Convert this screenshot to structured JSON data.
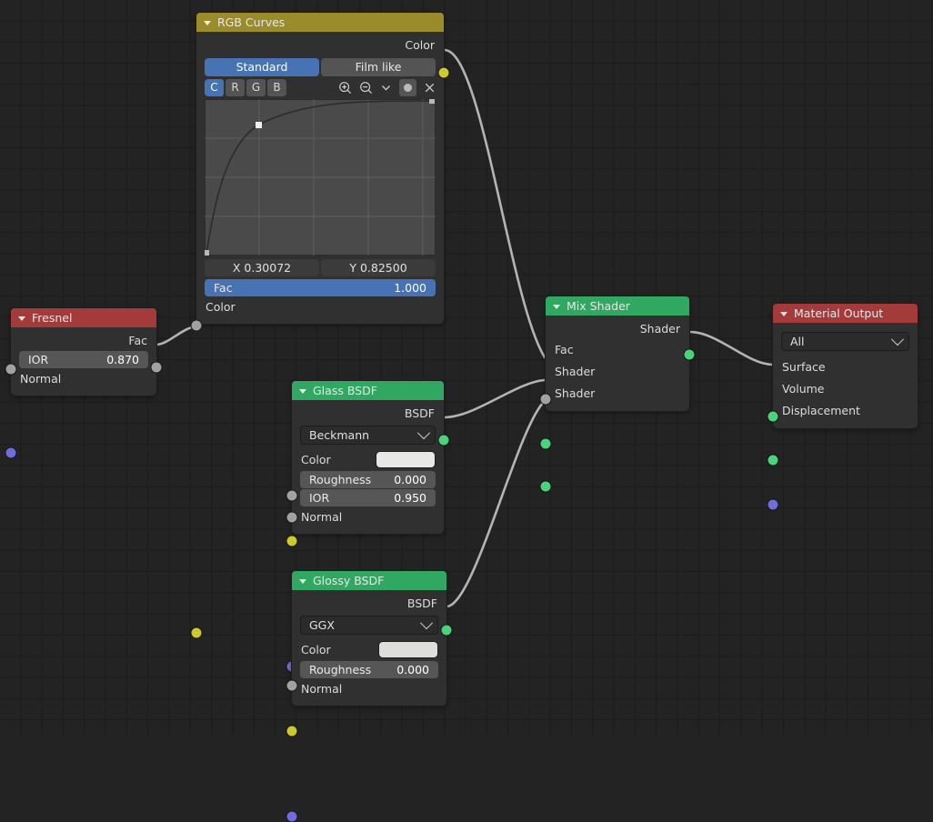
{
  "editor": {
    "name": "blender-shader-node-editor",
    "background_color": "#232323",
    "grid_color": "#1b1b1b",
    "wire_color": "#b0b0b0"
  },
  "socket_colors": {
    "color": "#ccc92e",
    "value": "#a1a1a1",
    "shader": "#4bd37b",
    "vector": "#6d6de0"
  },
  "nodes": {
    "rgb_curves": {
      "title": "RGB Curves",
      "header_color": "#9a8c2b",
      "outputs": [
        {
          "label": "Color",
          "socket": "color"
        }
      ],
      "view_modes": [
        {
          "label": "Standard",
          "active": true
        },
        {
          "label": "Film like",
          "active": false
        }
      ],
      "channels": [
        {
          "label": "C",
          "active": true
        },
        {
          "label": "R",
          "active": false
        },
        {
          "label": "G",
          "active": false
        },
        {
          "label": "B",
          "active": false
        }
      ],
      "tools": [
        {
          "name": "zoom-in-icon"
        },
        {
          "name": "zoom-out-icon"
        },
        {
          "name": "chevron-down-icon"
        },
        {
          "name": "clipping-icon"
        },
        {
          "name": "reset-curve-icon"
        }
      ],
      "point_x": "X 0.30072",
      "point_y": "Y 0.82500",
      "fac": {
        "label": "Fac",
        "value": "1.000",
        "socket": "value"
      },
      "color_input": {
        "label": "Color",
        "socket": "color"
      }
    },
    "fresnel": {
      "title": "Fresnel",
      "header_color": "#a33b3b",
      "outputs": [
        {
          "label": "Fac",
          "socket": "value"
        }
      ],
      "ior": {
        "label": "IOR",
        "value": "0.870",
        "socket": "value"
      },
      "normal": {
        "label": "Normal",
        "socket": "vector"
      }
    },
    "glass_bsdf": {
      "title": "Glass BSDF",
      "header_color": "#31a862",
      "outputs": [
        {
          "label": "BSDF",
          "socket": "shader"
        }
      ],
      "distribution": "Beckmann",
      "color": {
        "label": "Color",
        "socket": "color",
        "swatch": "#e8e8e6"
      },
      "roughness": {
        "label": "Roughness",
        "value": "0.000",
        "socket": "value"
      },
      "ior": {
        "label": "IOR",
        "value": "0.950",
        "socket": "value"
      },
      "normal": {
        "label": "Normal",
        "socket": "vector"
      }
    },
    "glossy_bsdf": {
      "title": "Glossy BSDF",
      "header_color": "#31a862",
      "outputs": [
        {
          "label": "BSDF",
          "socket": "shader"
        }
      ],
      "distribution": "GGX",
      "color": {
        "label": "Color",
        "socket": "color",
        "swatch": "#dededc"
      },
      "roughness": {
        "label": "Roughness",
        "value": "0.000",
        "socket": "value"
      },
      "normal": {
        "label": "Normal",
        "socket": "vector"
      }
    },
    "mix_shader": {
      "title": "Mix Shader",
      "header_color": "#31a862",
      "outputs": [
        {
          "label": "Shader",
          "socket": "shader"
        }
      ],
      "inputs": [
        {
          "label": "Fac",
          "socket": "value"
        },
        {
          "label": "Shader",
          "socket": "shader"
        },
        {
          "label": "Shader",
          "socket": "shader"
        }
      ]
    },
    "material_output": {
      "title": "Material Output",
      "header_color": "#a33b3b",
      "target": "All",
      "inputs": [
        {
          "label": "Surface",
          "socket": "shader"
        },
        {
          "label": "Volume",
          "socket": "shader"
        },
        {
          "label": "Displacement",
          "socket": "vector"
        }
      ]
    }
  }
}
